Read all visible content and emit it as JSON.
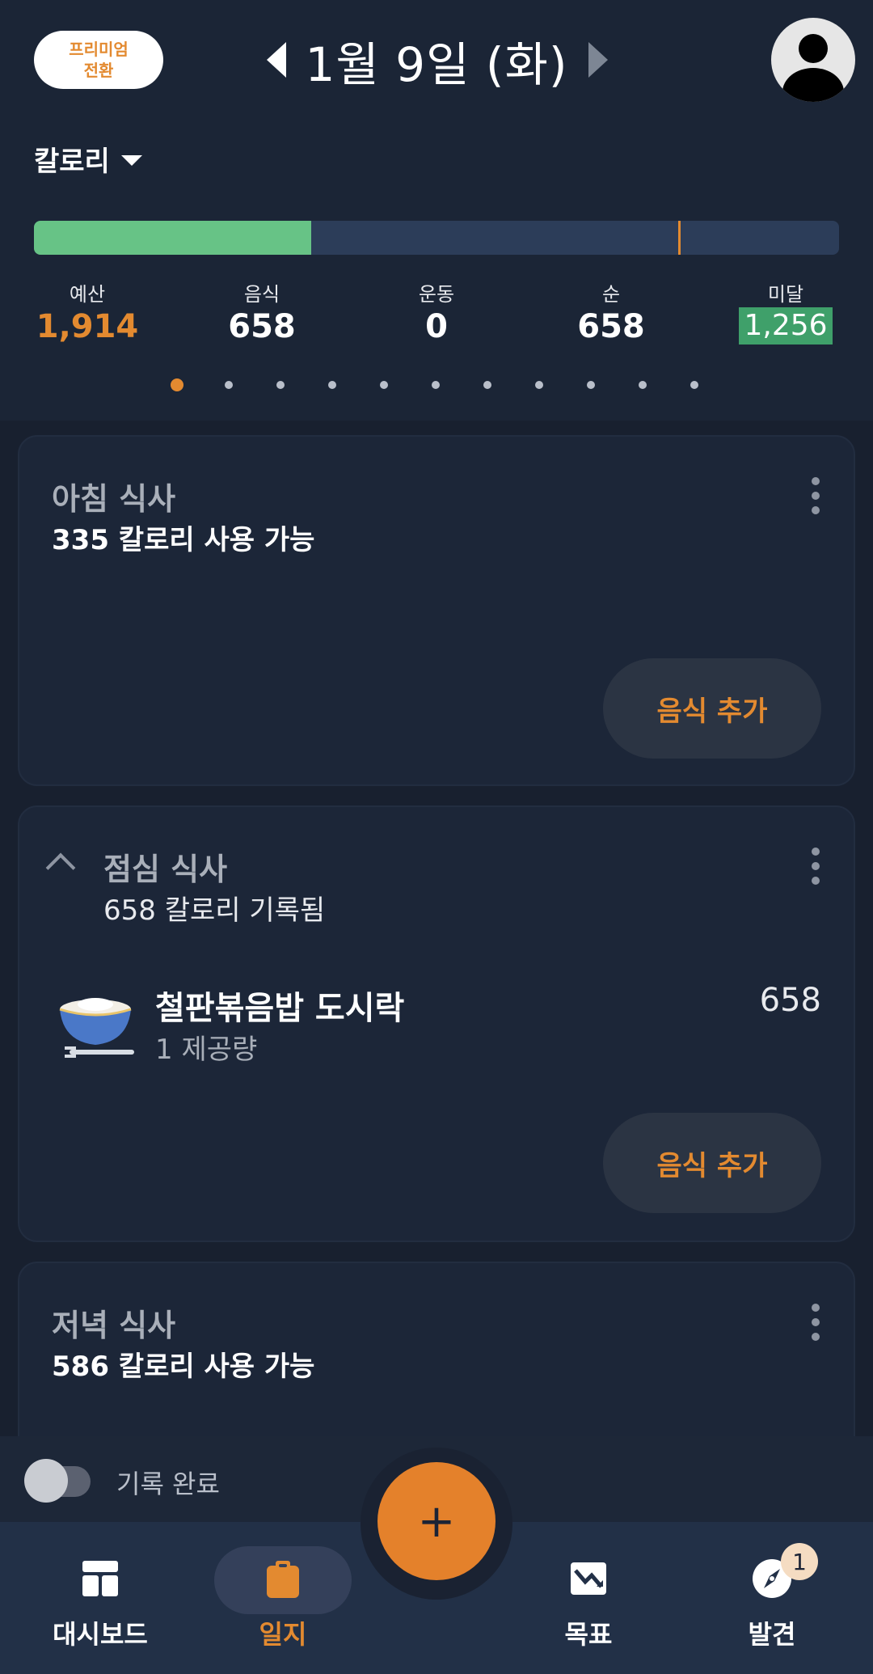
{
  "header": {
    "premium_line1": "프리미엄",
    "premium_line2": "전환",
    "date": "1월 9일 (화)"
  },
  "summary": {
    "metric": "칼로리",
    "progress_fraction": 0.344,
    "budget_marker_fraction": 0.8,
    "stats": [
      {
        "label": "예산",
        "value": "1,914"
      },
      {
        "label": "음식",
        "value": "658"
      },
      {
        "label": "운동",
        "value": "0"
      },
      {
        "label": "순",
        "value": "658"
      },
      {
        "label": "미달",
        "value": "1,256"
      }
    ],
    "page_count": 11,
    "active_page": 0
  },
  "meals": {
    "breakfast": {
      "title": "아침 식사",
      "status": "335 칼로리 사용 가능",
      "add_label": "음식 추가"
    },
    "lunch": {
      "title": "점심 식사",
      "status": "658 칼로리 기록됨",
      "add_label": "음식 추가",
      "items": [
        {
          "name": "철판볶음밥 도시락",
          "serving": "1 제공량",
          "calories": "658"
        }
      ]
    },
    "dinner": {
      "title": "저녁 식사",
      "status": "586 칼로리 사용 가능"
    }
  },
  "complete": {
    "label": "기록 완료",
    "toggled": false
  },
  "fab_label": "+",
  "nav": {
    "items": [
      {
        "label": "대시보드",
        "icon": "dashboard-icon"
      },
      {
        "label": "일지",
        "icon": "clipboard-icon"
      },
      {
        "label": "목표",
        "icon": "trend-chart-icon"
      },
      {
        "label": "발견",
        "icon": "compass-icon"
      }
    ],
    "active": 1,
    "discover_badge": "1"
  },
  "colors": {
    "accent": "#e38a30",
    "progress": "#67c386",
    "background": "#18202f",
    "surface": "#1b2536",
    "under_badge": "#3fa06a"
  }
}
